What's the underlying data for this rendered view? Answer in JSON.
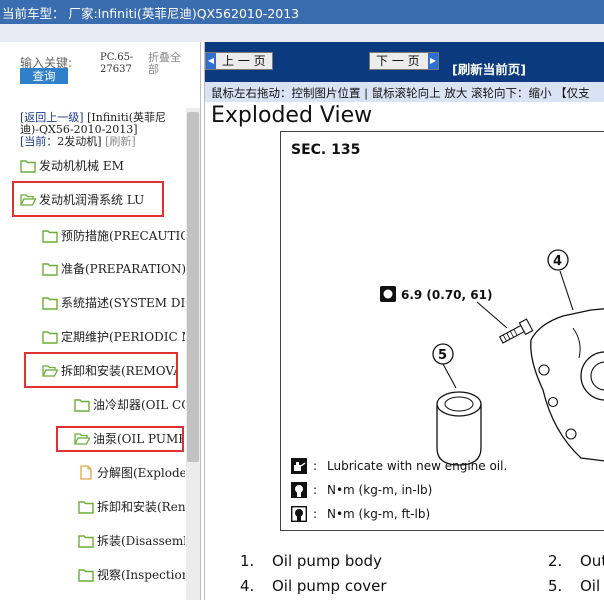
{
  "window": {
    "title": "当前车型：  厂家:Infiniti(英菲尼迪)QX562010-2013"
  },
  "sidebar": {
    "keyword_label": "输入关键:",
    "search_button": "查询",
    "pc_code": "PC.65-27637",
    "fold_all": "折叠全部",
    "back_link": "[返回上一级]",
    "back_model": "[Infiniti(英菲尼迪)-QX56-2010-2013]",
    "current_label": "[当前：",
    "current_value": "2发动机",
    "current_close": "]",
    "refresh_link": "[刷新]",
    "tree": [
      {
        "label": "发动机机械 EM",
        "type": "folder",
        "highlight": false
      },
      {
        "label": "发动机润滑系统 LU",
        "type": "folder",
        "highlight": true
      },
      {
        "label": "预防措施(PRECAUTIC",
        "type": "folder",
        "highlight": false
      },
      {
        "label": "准备(PREPARATION)",
        "type": "folder",
        "highlight": false
      },
      {
        "label": "系统描述(SYSTEM DI",
        "type": "folder",
        "highlight": false
      },
      {
        "label": "定期维护(PERIODIC M",
        "type": "folder",
        "highlight": false
      },
      {
        "label": "拆卸和安装(REMOVA",
        "type": "folder",
        "highlight": true
      },
      {
        "label": "油冷却器(OIL CO",
        "type": "folder",
        "highlight": false
      },
      {
        "label": "油泵(OIL PUMP",
        "type": "folder-open",
        "highlight": true
      },
      {
        "label": "分解图(Explode",
        "type": "document",
        "highlight": false
      },
      {
        "label": "拆卸和安装(Ren",
        "type": "folder",
        "highlight": false
      },
      {
        "label": "拆装(Disassemb",
        "type": "folder",
        "highlight": false
      },
      {
        "label": "视察(Inspection",
        "type": "folder",
        "highlight": false
      }
    ]
  },
  "content": {
    "prev_page": "上 一 页",
    "next_page": "下 一 页",
    "refresh_page": "[刷新当前页]",
    "hint": "鼠标左右拖动：控制图片位置 | 鼠标滚轮向上 放大  滚轮向下：缩小 【仅支",
    "heading": "Exploded View",
    "diagram": {
      "section": "SEC. 135",
      "torque_spec": "6.9 (0.70, 61)",
      "callout_4": "4",
      "callout_5": "5",
      "legend": [
        {
          "icon": "oil-can-icon",
          "text": "Lubricate with new engine oil."
        },
        {
          "icon": "torque-in-lb-icon",
          "text": "N•m (kg-m, in-lb)"
        },
        {
          "icon": "torque-ft-lb-icon",
          "text": "N•m (kg-m, ft-lb)"
        }
      ],
      "legend_colon": ":"
    },
    "parts": [
      {
        "num": "1.",
        "name": "Oil pump body"
      },
      {
        "num": "2.",
        "name": "Out"
      },
      {
        "num": "4.",
        "name": "Oil pump cover"
      },
      {
        "num": "5.",
        "name": "Oil"
      }
    ]
  },
  "colors": {
    "title_bar": "#3a6cb0",
    "content_toolbar": "#0b3a7e",
    "search_button": "#2f80c8",
    "highlight_box": "#e03030",
    "folder_icon": "#6cae3a"
  }
}
